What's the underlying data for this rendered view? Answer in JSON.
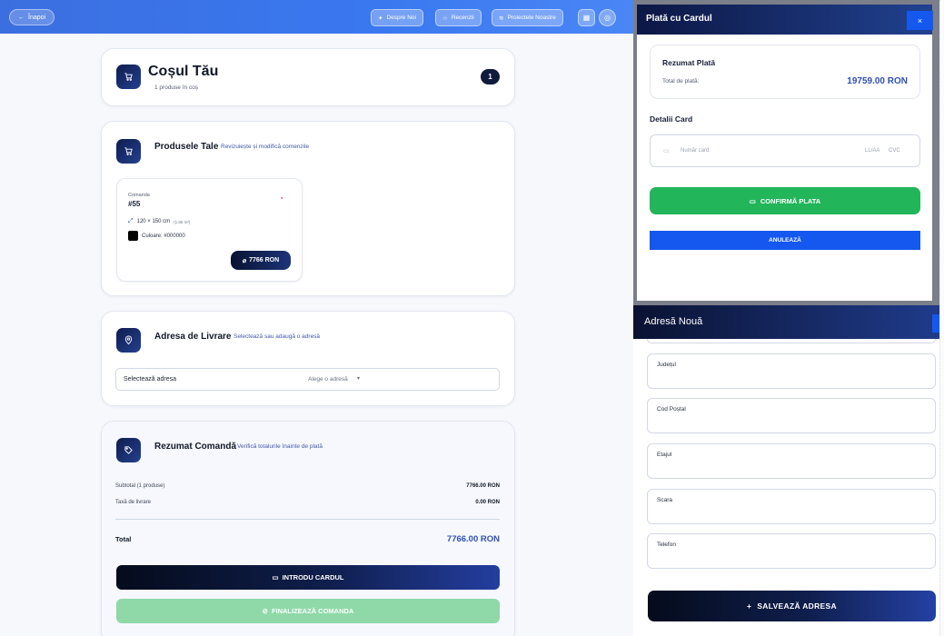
{
  "header": {
    "back_label": "Înapoi",
    "nav": [
      "Despre Noi",
      "Recenzii",
      "Proiectele Noastre"
    ]
  },
  "cart": {
    "title": "Coșul Tău",
    "count_text": "1 produse în coș",
    "badge": "1"
  },
  "products": {
    "title": "Produsele Tale",
    "subtitle": "Revizuiește și modifică comenzile",
    "item": {
      "order_label": "Comanda",
      "order_number": "#55",
      "dimensions": "120 × 150 cm",
      "area": "(1.80 m²)",
      "color_label": "Culoare: #000000",
      "color_hex": "#000000",
      "price": "7766 RON"
    }
  },
  "delivery": {
    "title": "Adresa de Livrare",
    "subtitle": "Selectează sau adaugă o adresă",
    "select_label": "Selectează adresa",
    "select_value": "Alege o adresă"
  },
  "summary": {
    "title": "Rezumat Comandă",
    "subtitle": "Verifică totalurile înainte de plată",
    "subtotal_label": "Subtotal (1 produse)",
    "subtotal_value": "7766.00 RON",
    "shipping_label": "Taxă de livrare",
    "shipping_value": "0.00 RON",
    "total_label": "Total",
    "total_value": "7766.00 RON",
    "card_button": "INTRODU CARDUL",
    "finalize_button": "FINALIZEAZĂ COMANDA"
  },
  "payment_modal": {
    "title": "Plată cu Cardul",
    "close": "×",
    "summary_title": "Rezumat Plată",
    "total_label": "Total de plată:",
    "total_value": "19759.00 RON",
    "card_details_title": "Detalii Card",
    "card_number_placeholder": "Număr card",
    "expiry_placeholder": "LL/AA",
    "cvc_placeholder": "CVC",
    "confirm_button": "CONFIRMĂ PLATA",
    "cancel_button": "ANULEAZĂ"
  },
  "address_modal": {
    "title": "Adresă Nouă",
    "fields": [
      "Județul",
      "Cod Poștal",
      "Etajul",
      "Scara",
      "Telefon"
    ],
    "save_button": "SALVEAZĂ ADRESA"
  },
  "colors": {
    "accent_blue": "#3b73ea",
    "navy": "#0f1b3d",
    "confirm_green": "#22b55a",
    "cancel_blue": "#1458ef",
    "finalize_green": "#8fd9a8",
    "price_blue": "#2f4fb5"
  }
}
